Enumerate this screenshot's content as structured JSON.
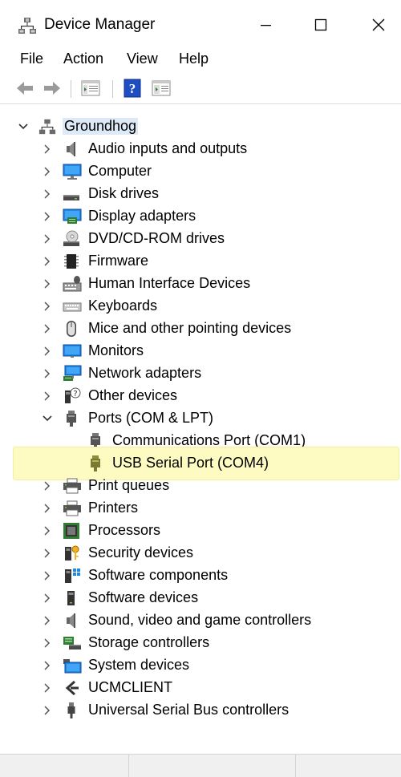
{
  "window": {
    "title": "Device Manager",
    "accent": "#0078d7"
  },
  "menu": {
    "file": "File",
    "action": "Action",
    "view": "View",
    "help": "Help"
  },
  "toolbar": {
    "icons": [
      "back-arrow-icon",
      "forward-arrow-icon",
      "properties-icon",
      "help-icon",
      "view-icon"
    ]
  },
  "tree": {
    "root": {
      "label": "Groundhog",
      "expanded": true
    },
    "items": [
      {
        "label": "Audio inputs and outputs",
        "icon": "speaker-icon"
      },
      {
        "label": "Computer",
        "icon": "monitor-icon"
      },
      {
        "label": "Disk drives",
        "icon": "disk-drive-icon"
      },
      {
        "label": "Display adapters",
        "icon": "display-adapter-icon"
      },
      {
        "label": "DVD/CD-ROM drives",
        "icon": "dvd-drive-icon"
      },
      {
        "label": "Firmware",
        "icon": "chip-icon"
      },
      {
        "label": "Human Interface Devices",
        "icon": "hid-icon"
      },
      {
        "label": "Keyboards",
        "icon": "keyboard-icon"
      },
      {
        "label": "Mice and other pointing devices",
        "icon": "mouse-icon"
      },
      {
        "label": "Monitors",
        "icon": "monitor-icon"
      },
      {
        "label": "Network adapters",
        "icon": "network-icon"
      },
      {
        "label": "Other devices",
        "icon": "unknown-device-icon"
      },
      {
        "label": "Ports (COM & LPT)",
        "icon": "port-icon",
        "expanded": true
      },
      {
        "label": "Communications Port (COM1)",
        "icon": "port-icon",
        "child": true
      },
      {
        "label": "USB Serial Port (COM4)",
        "icon": "port-icon",
        "child": true,
        "selected": true
      },
      {
        "label": "Print queues",
        "icon": "printer-icon"
      },
      {
        "label": "Printers",
        "icon": "printer-icon"
      },
      {
        "label": "Processors",
        "icon": "processor-icon"
      },
      {
        "label": "Security devices",
        "icon": "security-device-icon"
      },
      {
        "label": "Software components",
        "icon": "software-component-icon"
      },
      {
        "label": "Software devices",
        "icon": "software-device-icon"
      },
      {
        "label": "Sound, video and game controllers",
        "icon": "speaker-icon"
      },
      {
        "label": "Storage controllers",
        "icon": "storage-controller-icon"
      },
      {
        "label": "System devices",
        "icon": "system-devices-icon"
      },
      {
        "label": "UCMCLIENT",
        "icon": "ucm-client-icon"
      },
      {
        "label": "Universal Serial Bus controllers",
        "icon": "usb-icon"
      }
    ]
  },
  "selection_color": "#fefbc2"
}
